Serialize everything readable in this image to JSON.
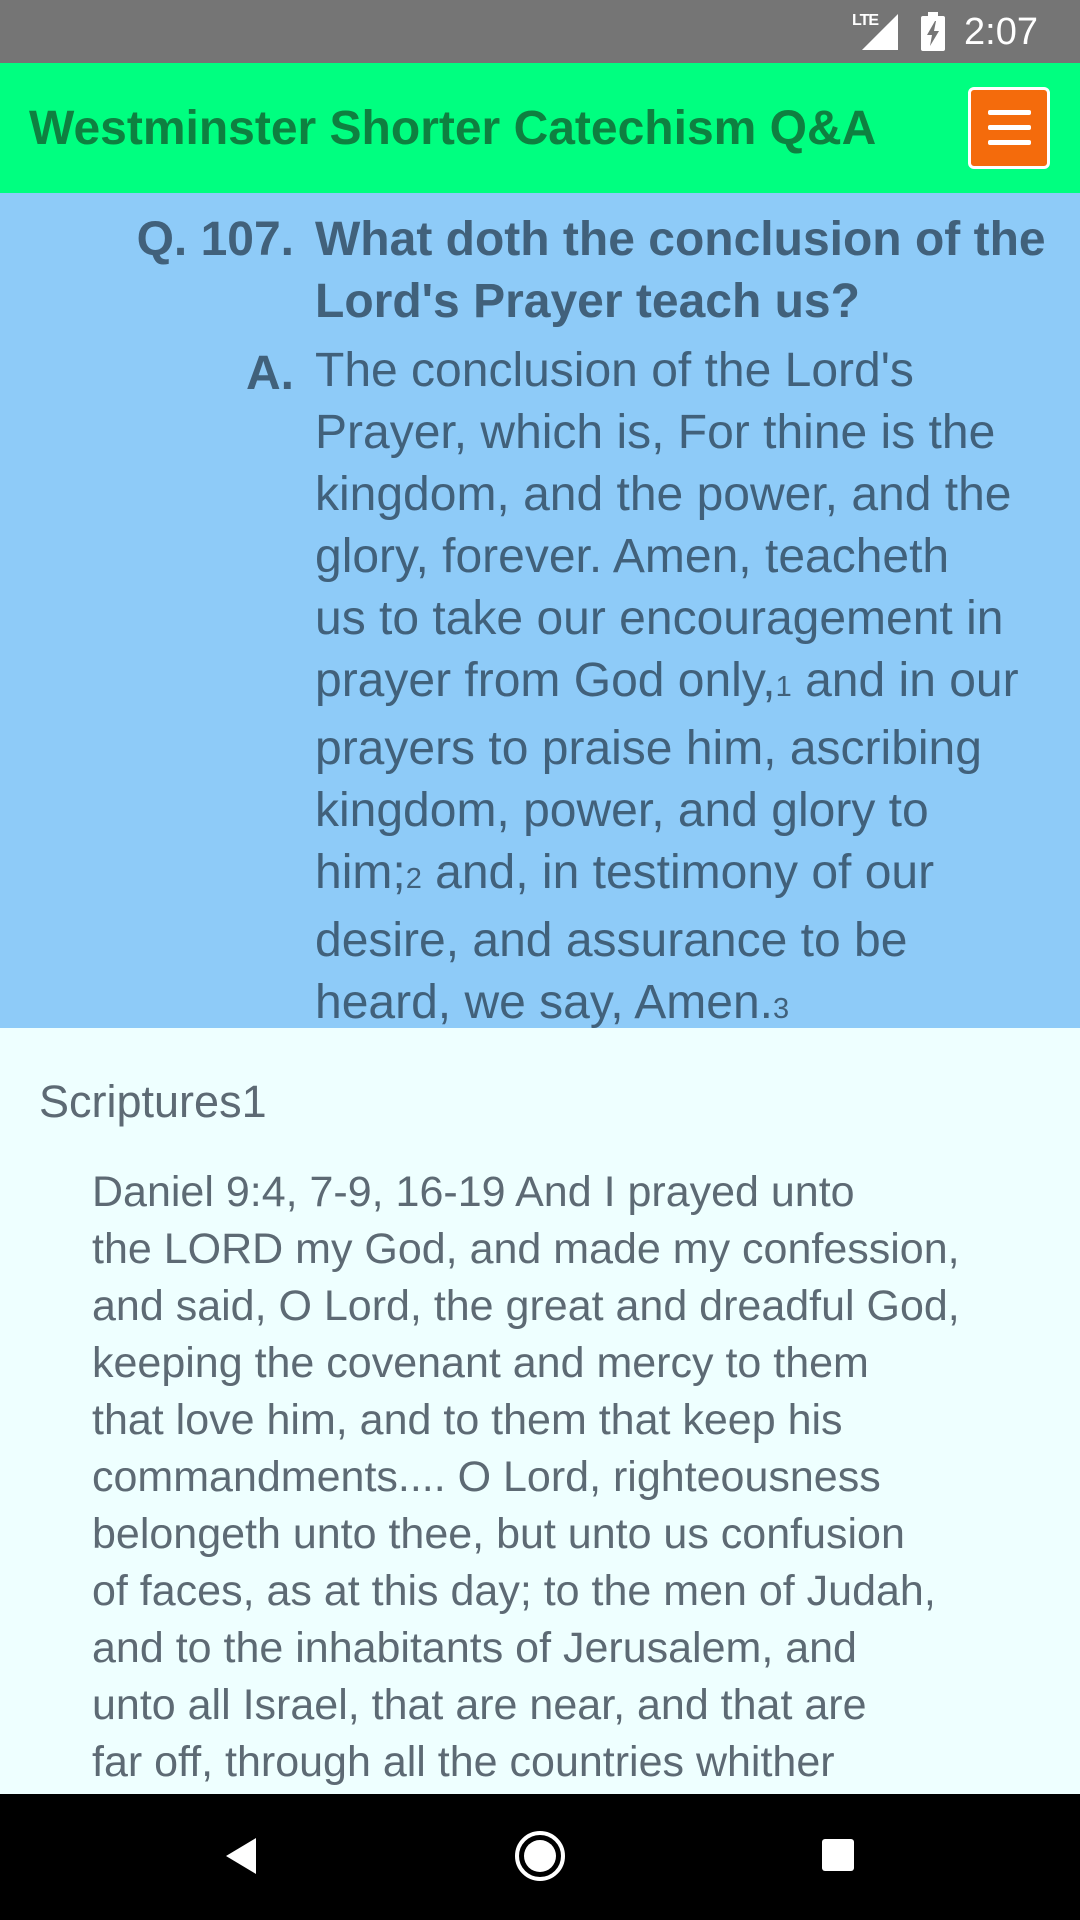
{
  "status_bar": {
    "network": "LTE",
    "time": "2:07"
  },
  "app_bar": {
    "title": "Westminster Shorter Catechism Q&A",
    "menu_icon": "hamburger-menu-icon",
    "colors": {
      "background": "#00ff80",
      "title": "#0e8040",
      "menu_button": "#f46b0c"
    }
  },
  "qa": {
    "question_label": "Q. 107.",
    "question_text": "What doth the conclusion of the Lord's Prayer teach us?",
    "answer_label": "A.",
    "answer_lines": [
      [
        {
          "t": "The conclusion of the Lord's"
        }
      ],
      [
        {
          "t": "Prayer, which is, For thine is the"
        }
      ],
      [
        {
          "t": "kingdom, and the power, and the"
        }
      ],
      [
        {
          "t": "glory, forever. Amen, teacheth"
        }
      ],
      [
        {
          "t": "us to take our encouragement in"
        }
      ],
      [
        {
          "t": "prayer from God only,"
        },
        {
          "t": "1",
          "fn": true
        },
        {
          "t": " and in our"
        }
      ],
      [
        {
          "t": "prayers to praise him, ascribing"
        }
      ],
      [
        {
          "t": "kingdom, power, and glory to"
        }
      ],
      [
        {
          "t": "him;"
        },
        {
          "t": "2",
          "fn": true
        },
        {
          "t": " and, in testimony of our"
        }
      ],
      [
        {
          "t": "desire, and assurance to be"
        }
      ],
      [
        {
          "t": "heard, we say, Amen."
        },
        {
          "t": "3",
          "fn": true
        }
      ]
    ],
    "colors": {
      "background": "#8ecbf8",
      "text": "#41617b"
    }
  },
  "scriptures": {
    "heading": "Scriptures1",
    "lines": [
      "Daniel 9:4, 7-9, 16-19     And I prayed unto",
      "the LORD my God, and made my confession,",
      "and said, O Lord, the great and dreadful God,",
      "keeping the covenant and mercy to them",
      "that love him, and to them that keep his",
      "commandments.... O Lord, righteousness",
      "belongeth unto thee, but unto us confusion",
      "of faces, as at this day; to the men of Judah,",
      "and to the inhabitants of Jerusalem, and",
      "unto all Israel, that are near, and that are",
      "far off, through all the countries whither"
    ],
    "colors": {
      "background": "#eeffff",
      "text": "#5d6a74"
    }
  },
  "nav_bar": {
    "back_icon": "back-triangle-icon",
    "home_icon": "home-circle-icon",
    "recents_icon": "recents-square-icon"
  }
}
